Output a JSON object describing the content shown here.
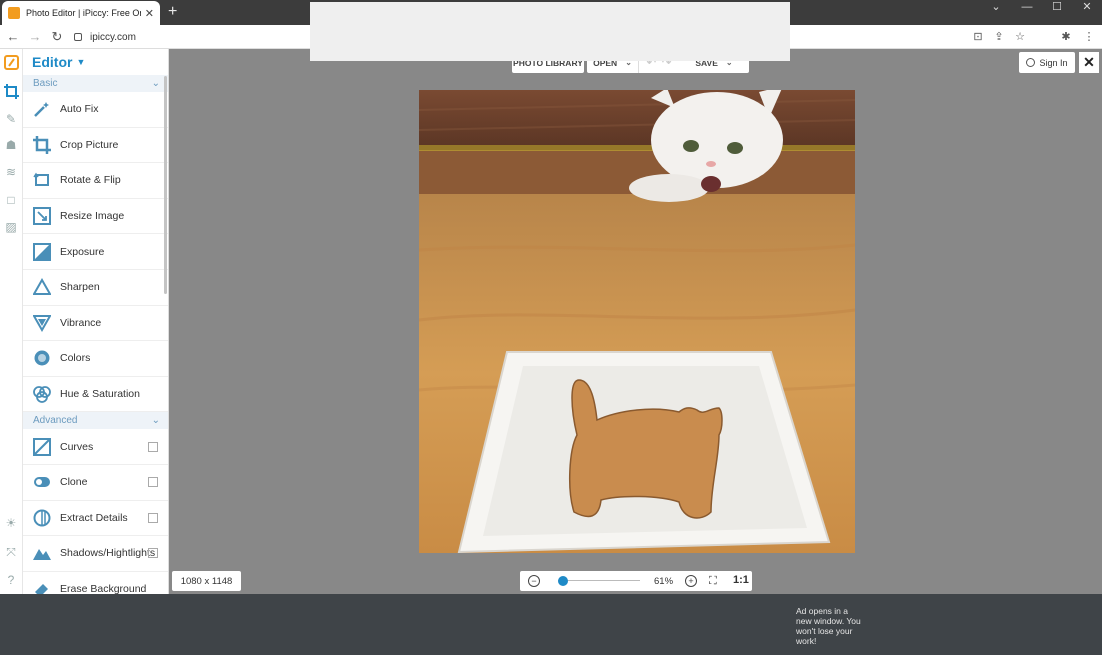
{
  "browser": {
    "tab_title": "Photo Editor | iPiccy: Free Online",
    "tab_close": "✕",
    "new_tab": "+",
    "url": "ipiccy.com",
    "window_controls": [
      "⌄",
      "—",
      "☐",
      "✕"
    ]
  },
  "editor": {
    "title": "Editor",
    "sections": {
      "basic": "Basic",
      "advanced": "Advanced"
    },
    "basic_tools": [
      {
        "label": "Auto Fix",
        "icon": "magic-wand-icon"
      },
      {
        "label": "Crop Picture",
        "icon": "crop-icon"
      },
      {
        "label": "Rotate & Flip",
        "icon": "rotate-icon"
      },
      {
        "label": "Resize Image",
        "icon": "resize-icon"
      },
      {
        "label": "Exposure",
        "icon": "exposure-icon"
      },
      {
        "label": "Sharpen",
        "icon": "triangle-icon"
      },
      {
        "label": "Vibrance",
        "icon": "vibrance-icon"
      },
      {
        "label": "Colors",
        "icon": "colors-icon"
      },
      {
        "label": "Hue & Saturation",
        "icon": "hue-icon"
      }
    ],
    "advanced_tools": [
      {
        "label": "Curves",
        "icon": "curves-icon"
      },
      {
        "label": "Clone",
        "icon": "clone-icon"
      },
      {
        "label": "Extract Details",
        "icon": "extract-icon"
      },
      {
        "label": "Shadows/Hightlights",
        "icon": "mountain-icon"
      },
      {
        "label": "Erase Background",
        "icon": "eraser-icon"
      }
    ]
  },
  "toolbar": {
    "photo_library": "PHOTO LIBRARY",
    "open": "OPEN",
    "save": "SAVE",
    "sign_in": "Sign In"
  },
  "status": {
    "dimensions": "1080 x 1148",
    "zoom_percent": "61%",
    "zoom_fraction": 0.06,
    "actual_size": "1:1"
  },
  "ad": {
    "note": "Ad opens in a new window. You won't lose your work!"
  },
  "colors": {
    "accent": "#1e8ac7",
    "brand_orange": "#f29c1f"
  }
}
